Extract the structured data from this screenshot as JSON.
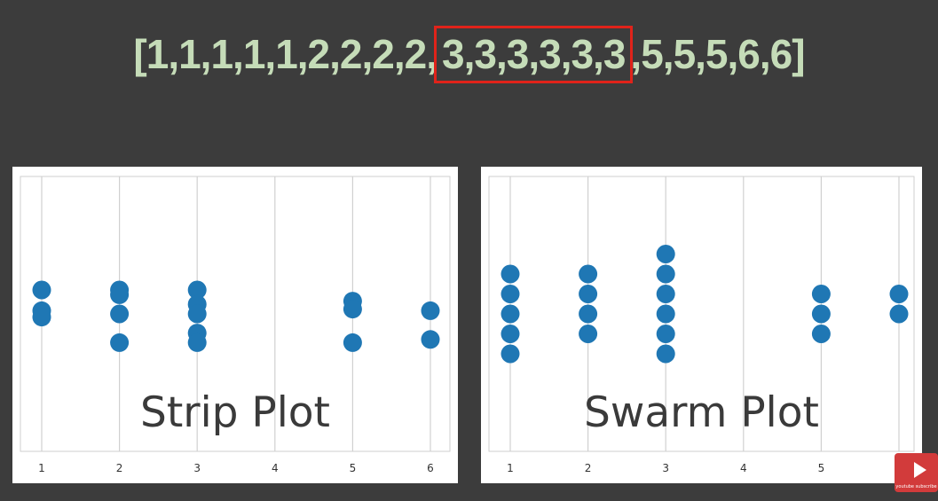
{
  "sequence": {
    "before": "[1,1,1,1,1,2,2,2,2,",
    "highlighted": "3,3,3,3,3,3",
    "after": ",5,5,5,6,6]"
  },
  "colors": {
    "background": "#3c3c3c",
    "sequence_text": "#c5dcb8",
    "highlight_box": "#e0231a",
    "dots": "#1f77b4",
    "grid": "#d0d0d0"
  },
  "chart_data": [
    {
      "type": "scatter",
      "label": "Strip Plot",
      "x_ticks": [
        "1",
        "2",
        "3",
        "4",
        "5",
        "6"
      ],
      "xlim": [
        0.97,
        6.07
      ],
      "grid": "vertical",
      "points": [
        {
          "x": 1,
          "y": 0.15
        },
        {
          "x": 1,
          "y": 0.02
        },
        {
          "x": 1,
          "y": -0.02
        },
        {
          "x": 2,
          "y": 0.15
        },
        {
          "x": 2,
          "y": 0.12
        },
        {
          "x": 2,
          "y": 0.0
        },
        {
          "x": 2,
          "y": -0.18
        },
        {
          "x": 3,
          "y": 0.15
        },
        {
          "x": 3,
          "y": 0.06
        },
        {
          "x": 3,
          "y": 0.0
        },
        {
          "x": 3,
          "y": -0.12
        },
        {
          "x": 3,
          "y": -0.18
        },
        {
          "x": 5,
          "y": 0.08
        },
        {
          "x": 5,
          "y": 0.03
        },
        {
          "x": 5,
          "y": -0.18
        },
        {
          "x": 6,
          "y": 0.02
        },
        {
          "x": 6,
          "y": -0.16
        }
      ]
    },
    {
      "type": "scatter",
      "label": "Swarm Plot",
      "x_ticks": [
        "1",
        "2",
        "3",
        "4",
        "5",
        "6"
      ],
      "xlim": [
        0.97,
        6.07
      ],
      "grid": "vertical",
      "points": [
        {
          "x": 1,
          "y": 0.25
        },
        {
          "x": 1,
          "y": 0.125
        },
        {
          "x": 1,
          "y": 0.0
        },
        {
          "x": 1,
          "y": -0.125
        },
        {
          "x": 1,
          "y": -0.25
        },
        {
          "x": 2,
          "y": 0.25
        },
        {
          "x": 2,
          "y": 0.125
        },
        {
          "x": 2,
          "y": 0.0
        },
        {
          "x": 2,
          "y": -0.125
        },
        {
          "x": 3,
          "y": 0.375
        },
        {
          "x": 3,
          "y": 0.25
        },
        {
          "x": 3,
          "y": 0.125
        },
        {
          "x": 3,
          "y": 0.0
        },
        {
          "x": 3,
          "y": -0.125
        },
        {
          "x": 3,
          "y": -0.25
        },
        {
          "x": 5,
          "y": 0.125
        },
        {
          "x": 5,
          "y": 0.0
        },
        {
          "x": 5,
          "y": -0.125
        },
        {
          "x": 6,
          "y": 0.125
        },
        {
          "x": 6,
          "y": 0.0
        }
      ]
    }
  ],
  "youtube_badge": {
    "icon": "play-icon",
    "text": "youtube subscribe"
  }
}
